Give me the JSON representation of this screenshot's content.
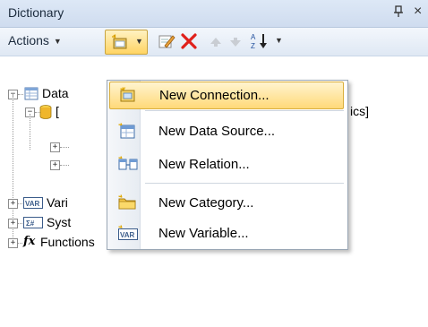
{
  "panel": {
    "title": "Dictionary",
    "pin_glyph": "ꟸ",
    "close_glyph": "×"
  },
  "toolbar": {
    "actions_label": "Actions",
    "icons": [
      "new-item-icon",
      "edit-icon",
      "delete-icon",
      "move-up-icon",
      "move-down-icon",
      "sort-icon"
    ]
  },
  "tree": {
    "data_sources": "Data",
    "connection_prefix": "[",
    "connection_suffix": "ics]",
    "variables": "Vari",
    "system_variables": "Syst",
    "functions": "Functions"
  },
  "menu": {
    "items": [
      {
        "label": "New Connection...",
        "icon": "new-connection-icon"
      },
      {
        "label": "New Data Source...",
        "icon": "new-data-source-icon"
      },
      {
        "label": "New Relation...",
        "icon": "new-relation-icon"
      },
      {
        "label": "New Category...",
        "icon": "new-category-icon"
      },
      {
        "label": "New Variable...",
        "icon": "new-variable-icon"
      }
    ]
  },
  "colors": {
    "highlight": "#ffd978",
    "delete_red": "#e0201b",
    "titlebar": "#d5e1f1"
  }
}
